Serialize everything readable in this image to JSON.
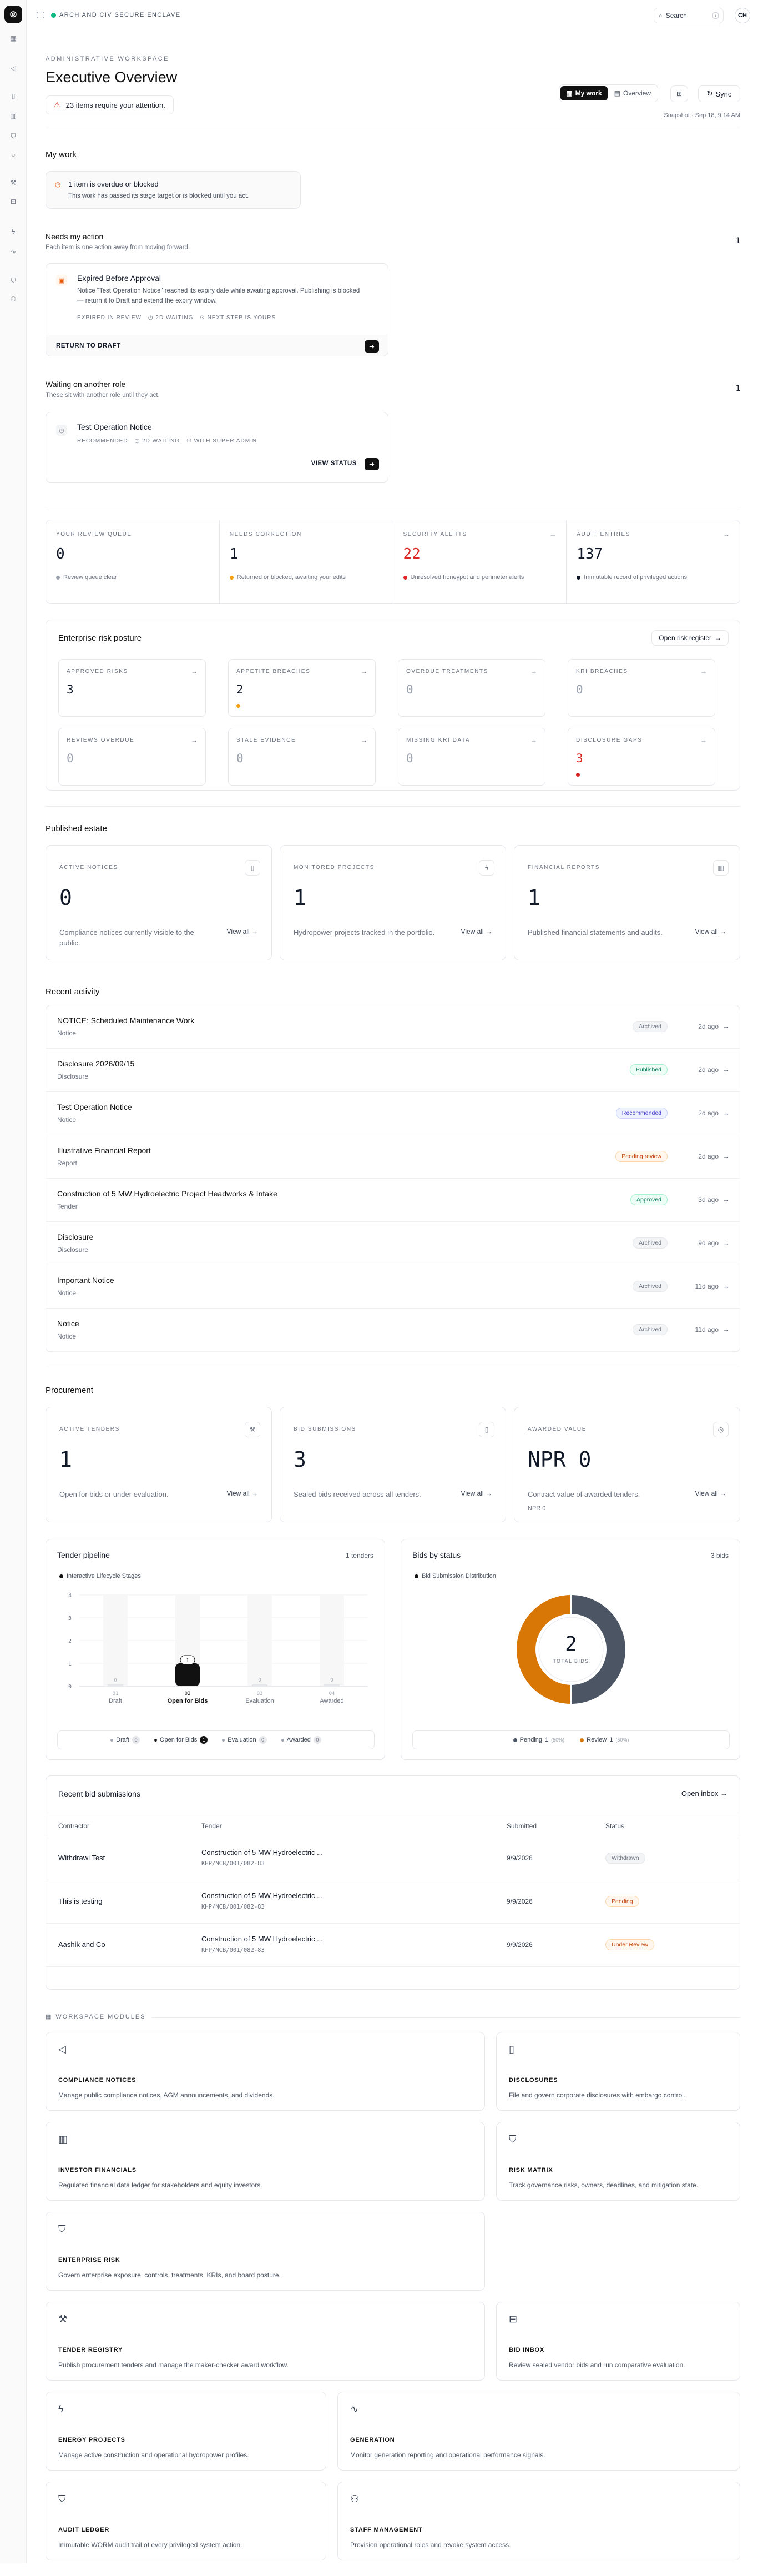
{
  "app": {
    "org": "ARCH AND CIV SECURE ENCLAVE",
    "search_label": "Search",
    "search_kbd": "/",
    "avatar": "CH"
  },
  "header": {
    "eyebrow": "ADMINISTRATIVE WORKSPACE",
    "title": "Executive Overview",
    "alert": "23 items require your attention.",
    "tabs": [
      "My work",
      "Overview"
    ],
    "sync": "Sync",
    "snapshot": "Snapshot · Sep 18, 9:14 AM"
  },
  "my_work": {
    "title": "My work",
    "overdue_title": "1 item is overdue or blocked",
    "overdue_sub": "This work has passed its stage target or is blocked until you act.",
    "needs": {
      "title": "Needs my action",
      "sub": "Each item is one action away from moving forward.",
      "count": "1"
    },
    "action_card": {
      "title": "Expired Before Approval",
      "desc": "Notice \"Test Operation Notice\" reached its expiry date while awaiting approval. Publishing is blocked — return it to Draft and extend the expiry window.",
      "meta": [
        "EXPIRED IN REVIEW",
        "2D WAITING",
        "NEXT STEP IS YOURS"
      ],
      "cta": "RETURN TO DRAFT"
    },
    "waiting": {
      "title": "Waiting on another role",
      "sub": "These sit with another role until they act.",
      "count": "1"
    },
    "waiting_card": {
      "title": "Test Operation Notice",
      "meta": [
        "RECOMMENDED",
        "2D WAITING",
        "WITH SUPER ADMIN"
      ],
      "cta": "VIEW STATUS"
    }
  },
  "kpis": [
    {
      "label": "YOUR REVIEW QUEUE",
      "value": "0",
      "note": "Review queue clear",
      "dot": "#9ca3af"
    },
    {
      "label": "NEEDS CORRECTION",
      "value": "1",
      "note": "Returned or blocked, awaiting your edits",
      "dot": "#f59e0b"
    },
    {
      "label": "SECURITY ALERTS",
      "value": "22",
      "note": "Unresolved honeypot and perimeter alerts",
      "dot": "#dc2626",
      "value_color": "#dc2626"
    },
    {
      "label": "AUDIT ENTRIES",
      "value": "137",
      "note": "Immutable record of privileged actions",
      "dot": "#111827"
    }
  ],
  "risk": {
    "title": "Enterprise risk posture",
    "open": "Open risk register",
    "tiles": [
      {
        "label": "APPROVED RISKS",
        "value": "3"
      },
      {
        "label": "APPETITE BREACHES",
        "value": "2",
        "dot": "#f59e0b"
      },
      {
        "label": "OVERDUE TREATMENTS",
        "value": "0"
      },
      {
        "label": "KRI BREACHES",
        "value": "0"
      },
      {
        "label": "REVIEWS OVERDUE",
        "value": "0"
      },
      {
        "label": "STALE EVIDENCE",
        "value": "0"
      },
      {
        "label": "MISSING KRI DATA",
        "value": "0"
      },
      {
        "label": "DISCLOSURE GAPS",
        "value": "3",
        "dot": "#dc2626",
        "value_color": "#dc2626"
      }
    ]
  },
  "estate": {
    "title": "Published estate",
    "cards": [
      {
        "label": "ACTIVE NOTICES",
        "value": "0",
        "desc": "Compliance notices currently visible to the public.",
        "link": "View all →"
      },
      {
        "label": "MONITORED PROJECTS",
        "value": "1",
        "desc": "Hydropower projects tracked in the portfolio.",
        "link": "View all →"
      },
      {
        "label": "FINANCIAL REPORTS",
        "value": "1",
        "desc": "Published financial statements and audits.",
        "link": "View all →"
      }
    ]
  },
  "activity": {
    "title": "Recent activity",
    "rows": [
      {
        "title": "NOTICE: Scheduled Maintenance Work",
        "type": "Notice",
        "status": "Archived",
        "cls": "b-arch",
        "ago": "2d ago"
      },
      {
        "title": "Disclosure 2026/09/15",
        "type": "Disclosure",
        "status": "Published",
        "cls": "b-pub",
        "ago": "2d ago"
      },
      {
        "title": "Test Operation Notice",
        "type": "Notice",
        "status": "Recommended",
        "cls": "b-rec",
        "ago": "2d ago"
      },
      {
        "title": "Illustrative Financial Report",
        "type": "Report",
        "status": "Pending review",
        "cls": "b-pend",
        "ago": "2d ago"
      },
      {
        "title": "Construction of 5 MW Hydroelectric Project Headworks & Intake",
        "type": "Tender",
        "status": "Approved",
        "cls": "b-appr",
        "ago": "3d ago"
      },
      {
        "title": "Disclosure",
        "type": "Disclosure",
        "status": "Archived",
        "cls": "b-arch",
        "ago": "9d ago"
      },
      {
        "title": "Important Notice",
        "type": "Notice",
        "status": "Archived",
        "cls": "b-arch",
        "ago": "11d ago"
      },
      {
        "title": "Notice",
        "type": "Notice",
        "status": "Archived",
        "cls": "b-arch",
        "ago": "11d ago"
      }
    ]
  },
  "procurement": {
    "title": "Procurement",
    "cards": [
      {
        "label": "ACTIVE TENDERS",
        "value": "1",
        "desc": "Open for bids or under evaluation.",
        "link": "View all →"
      },
      {
        "label": "BID SUBMISSIONS",
        "value": "3",
        "desc": "Sealed bids received across all tenders.",
        "link": "View all →"
      },
      {
        "label": "AWARDED VALUE",
        "value": "NPR 0",
        "desc": "Contract value of awarded tenders.",
        "extra": "NPR 0",
        "link": "View all →"
      }
    ]
  },
  "pipeline": {
    "title": "Tender pipeline",
    "count": "1 tenders",
    "legend": "Interactive Lifecycle Stages",
    "chips": [
      {
        "label": "Draft",
        "n": "0"
      },
      {
        "label": "Open for Bids",
        "n": "1"
      },
      {
        "label": "Evaluation",
        "n": "0"
      },
      {
        "label": "Awarded",
        "n": "0"
      }
    ]
  },
  "bids": {
    "title": "Bids by status",
    "count": "3 bids",
    "legend": "Bid Submission Distribution",
    "center_value": "2",
    "center_label": "TOTAL BIDS",
    "chips": [
      {
        "label": "Pending",
        "n": "1",
        "pct": "(50%)",
        "color": "#4b5563"
      },
      {
        "label": "Review",
        "n": "1",
        "pct": "(50%)",
        "color": "#d97706"
      }
    ]
  },
  "chart_data": [
    {
      "type": "bar",
      "title": "Tender pipeline",
      "categories": [
        "Draft",
        "Open for Bids",
        "Evaluation",
        "Awarded"
      ],
      "tick_labels": [
        "01",
        "02",
        "03",
        "04"
      ],
      "values": [
        0,
        1,
        0,
        0
      ],
      "ylim": [
        0,
        4
      ],
      "yticks": [
        0,
        1,
        2,
        3,
        4
      ],
      "highlight": "Open for Bids"
    },
    {
      "type": "pie",
      "title": "Bids by status",
      "categories": [
        "Pending",
        "Review"
      ],
      "values": [
        1,
        1
      ],
      "colors": [
        "#4b5563",
        "#d97706"
      ]
    }
  ],
  "recent_bids": {
    "title": "Recent bid submissions",
    "open": "Open inbox →",
    "headers": [
      "Contractor",
      "Tender",
      "Submitted",
      "Status"
    ],
    "rows": [
      {
        "contractor": "Withdrawl Test",
        "tender": "Construction of 5 MW Hydroelectric ...",
        "code": "KHP/NCB/001/082-83",
        "date": "9/9/2026",
        "status": "Withdrawn",
        "cls": "b-wd"
      },
      {
        "contractor": "This is testing",
        "tender": "Construction of 5 MW Hydroelectric ...",
        "code": "KHP/NCB/001/082-83",
        "date": "9/9/2026",
        "status": "Pending",
        "cls": "b-pend"
      },
      {
        "contractor": "Aashik and Co",
        "tender": "Construction of 5 MW Hydroelectric ...",
        "code": "KHP/NCB/001/082-83",
        "date": "9/9/2026",
        "status": "Under Review",
        "cls": "b-pend"
      }
    ]
  },
  "modules": {
    "title": "WORKSPACE MODULES",
    "items": [
      {
        "title": "COMPLIANCE NOTICES",
        "desc": "Manage public compliance notices, AGM announcements, and dividends.",
        "icon": "megaphone-icon",
        "glyph": "◁"
      },
      {
        "title": "DISCLOSURES",
        "desc": "File and govern corporate disclosures with embargo control.",
        "icon": "document-icon",
        "glyph": "▯"
      },
      {
        "title": "INVESTOR FINANCIALS",
        "desc": "Regulated financial data ledger for stakeholders and equity investors.",
        "icon": "bar-chart-icon",
        "glyph": "▥"
      },
      {
        "title": "RISK MATRIX",
        "desc": "Track governance risks, owners, deadlines, and mitigation state.",
        "icon": "shield-check-icon",
        "glyph": "⛉"
      },
      {
        "title": "ENTERPRISE RISK",
        "desc": "Govern enterprise exposure, controls, treatments, KRIs, and board posture.",
        "icon": "shield-icon",
        "glyph": "⛉"
      },
      {
        "title": "TENDER REGISTRY",
        "desc": "Publish procurement tenders and manage the maker-checker award workflow.",
        "icon": "gavel-icon",
        "glyph": "⚒"
      },
      {
        "title": "BID INBOX",
        "desc": "Review sealed vendor bids and run comparative evaluation.",
        "icon": "inbox-icon",
        "glyph": "⊟"
      },
      {
        "title": "ENERGY PROJECTS",
        "desc": "Manage active construction and operational hydropower profiles.",
        "icon": "bolt-icon",
        "glyph": "ϟ"
      },
      {
        "title": "GENERATION",
        "desc": "Monitor generation reporting and operational performance signals.",
        "icon": "activity-icon",
        "glyph": "∿"
      },
      {
        "title": "AUDIT LEDGER",
        "desc": "Immutable WORM audit trail of every privileged system action.",
        "icon": "shield-icon",
        "glyph": "⛉"
      },
      {
        "title": "STAFF MANAGEMENT",
        "desc": "Provision operational roles and revoke system access.",
        "icon": "users-icon",
        "glyph": "⚇"
      }
    ]
  }
}
